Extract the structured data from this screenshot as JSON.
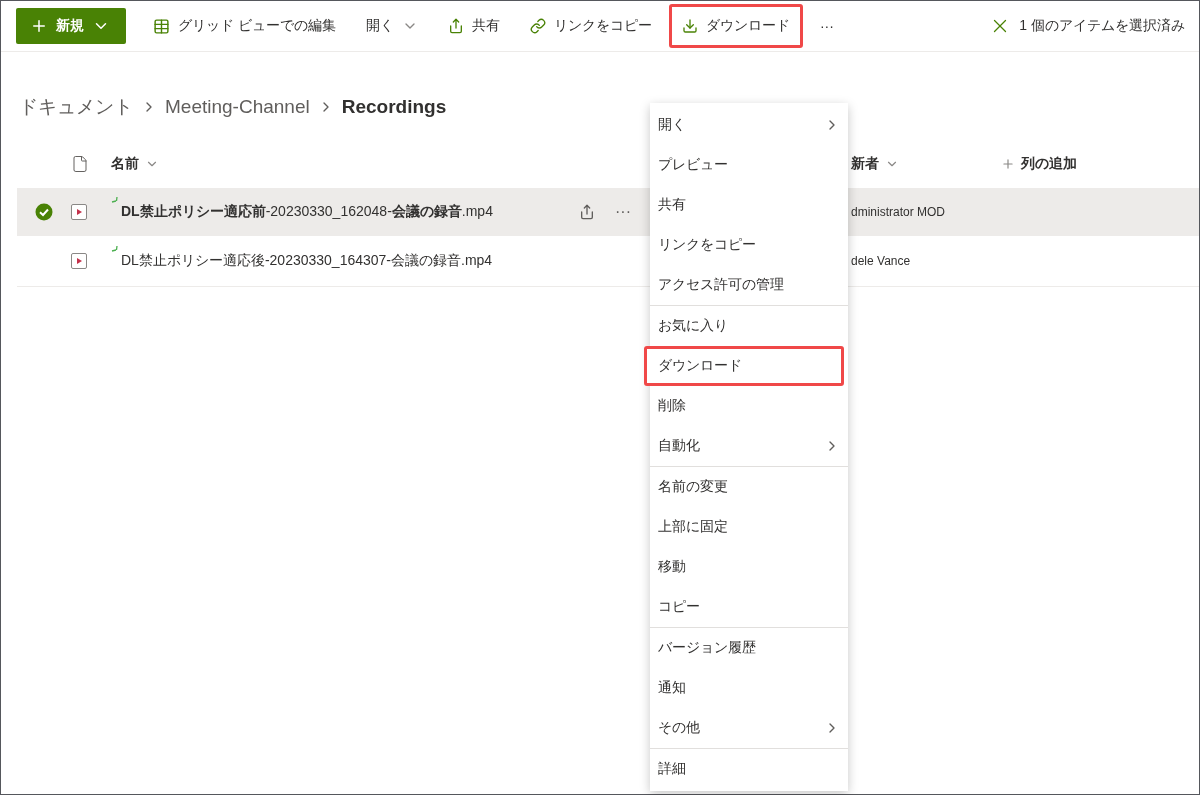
{
  "toolbar": {
    "new_button": {
      "label": "新規"
    },
    "items": [
      {
        "kind": "button",
        "label": "グリッド ビューでの編集",
        "highlighted": false
      },
      {
        "kind": "dropdown",
        "label": "開く",
        "highlighted": false
      },
      {
        "kind": "button",
        "label": "共有",
        "highlighted": false
      },
      {
        "kind": "button",
        "label": "リンクをコピー",
        "highlighted": false
      },
      {
        "kind": "button",
        "label": "ダウンロード",
        "highlighted": true
      },
      {
        "kind": "more",
        "label": "···",
        "highlighted": false
      }
    ],
    "selection": {
      "label": "1 個のアイテムを選択済み"
    }
  },
  "breadcrumb": [
    "ドキュメント",
    "Meeting-Channel",
    "Recordings"
  ],
  "table": {
    "columns": [
      {
        "label": "名前",
        "sortable": true
      },
      {
        "label": "新者",
        "sortable": true
      },
      {
        "label": "列の追加",
        "sortable": false
      }
    ],
    "rows": [
      {
        "name": "**DL禁止ポリシー適応前**-20230330_162048-**会議の録音**.mp4",
        "modified_by": "dministrator MOD",
        "selected": true,
        "more": "···"
      },
      {
        "name": "DL禁止ポリシー適応後-20230330_164307-会議の録音.mp4",
        "modified_by": "dele Vance",
        "selected": false
      }
    ]
  },
  "context_menu": {
    "groups": [
      [
        {
          "label": "開く",
          "submenu": true,
          "highlighted": false
        },
        {
          "label": "プレビュー",
          "submenu": false,
          "highlighted": false
        },
        {
          "label": "共有",
          "submenu": false,
          "highlighted": false
        },
        {
          "label": "リンクをコピー",
          "submenu": false,
          "highlighted": false
        },
        {
          "label": "アクセス許可の管理",
          "submenu": false,
          "highlighted": false
        }
      ],
      [
        {
          "label": "お気に入り",
          "submenu": false,
          "highlighted": false
        },
        {
          "label": "ダウンロード",
          "submenu": false,
          "highlighted": true
        },
        {
          "label": "削除",
          "submenu": false,
          "highlighted": false
        },
        {
          "label": "自動化",
          "submenu": true,
          "highlighted": false
        }
      ],
      [
        {
          "label": "名前の変更",
          "submenu": false,
          "highlighted": false
        },
        {
          "label": "上部に固定",
          "submenu": false,
          "highlighted": false
        },
        {
          "label": "移動",
          "submenu": false,
          "highlighted": false
        },
        {
          "label": "コピー",
          "submenu": false,
          "highlighted": false
        }
      ],
      [
        {
          "label": "バージョン履歴",
          "submenu": false,
          "highlighted": false
        },
        {
          "label": "通知",
          "submenu": false,
          "highlighted": false
        },
        {
          "label": "その他",
          "submenu": true,
          "highlighted": false
        }
      ],
      [
        {
          "label": "詳細",
          "submenu": false,
          "highlighted": false
        }
      ]
    ]
  }
}
